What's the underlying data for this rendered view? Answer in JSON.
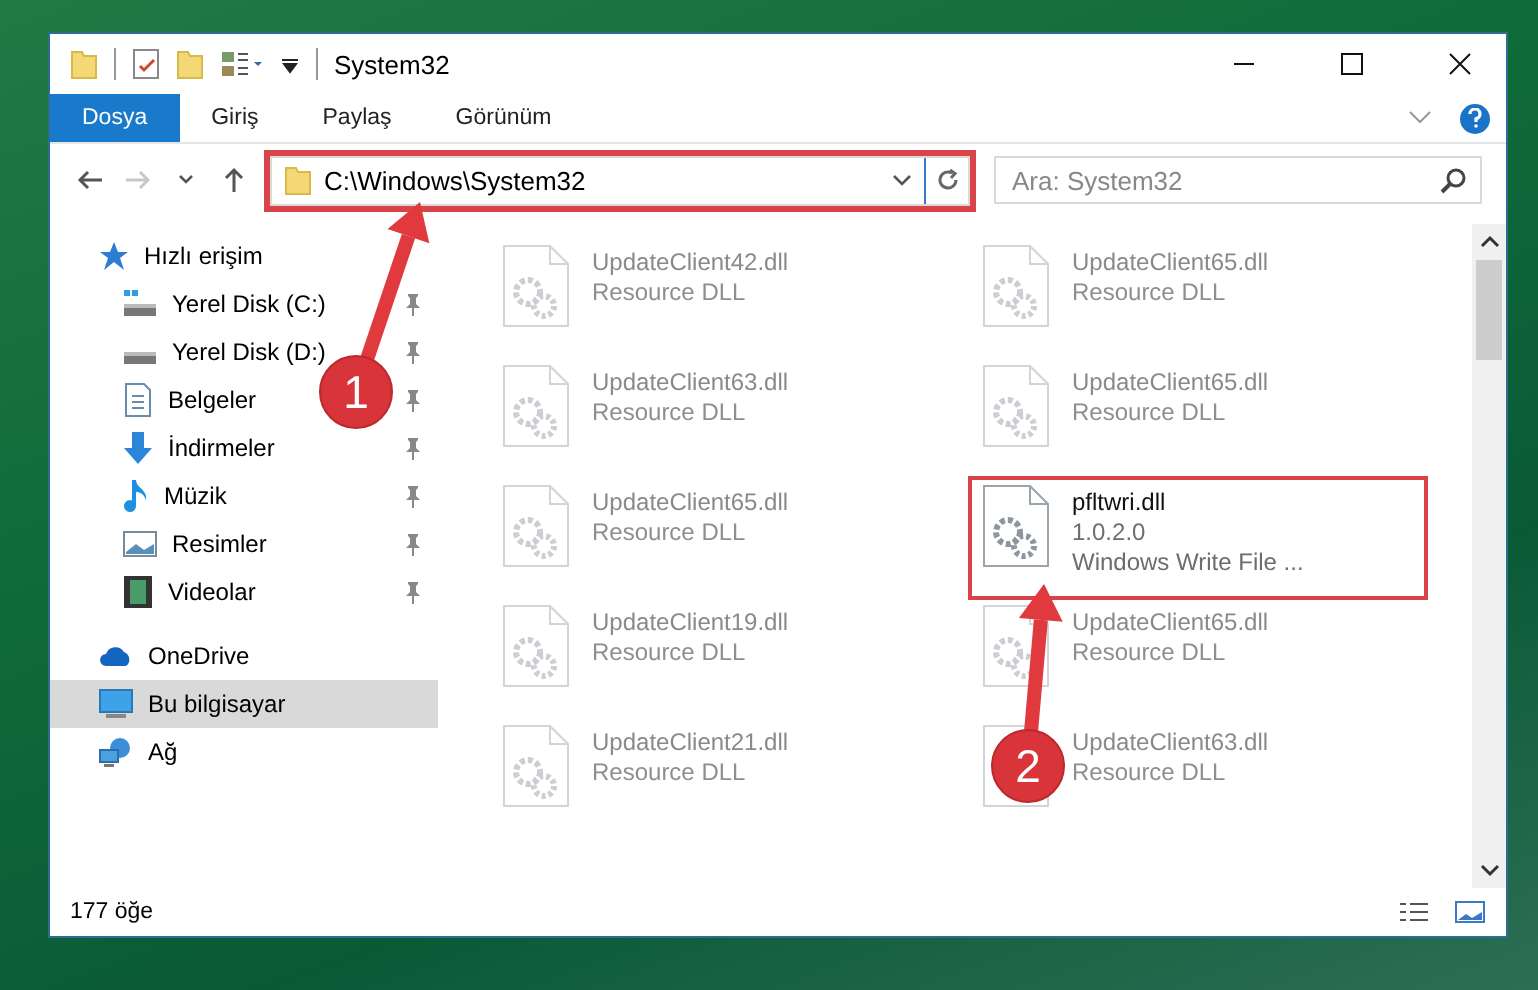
{
  "window": {
    "title": "System32"
  },
  "ribbon": {
    "tabs": [
      {
        "label": "Dosya",
        "selected": true
      },
      {
        "label": "Giriş",
        "selected": false
      },
      {
        "label": "Paylaş",
        "selected": false
      },
      {
        "label": "Görünüm",
        "selected": false
      }
    ]
  },
  "navigation": {
    "forward_disabled": true,
    "address": {
      "value": "C:\\Windows\\System32",
      "highlighted": true
    },
    "search": {
      "placeholder": "Ara: System32"
    }
  },
  "sidebar": {
    "items": [
      {
        "label": "Hızlı erişim",
        "kind": "star",
        "selected": false,
        "children": [
          {
            "label": "Yerel Disk (C:)",
            "kind": "system-drive",
            "pinned": true,
            "selected": false
          },
          {
            "label": "Yerel Disk (D:)",
            "kind": "drive",
            "pinned": true,
            "selected": false
          },
          {
            "label": "Belgeler",
            "kind": "documents",
            "pinned": true,
            "selected": false
          },
          {
            "label": "İndirmeler",
            "kind": "downloads",
            "pinned": true,
            "selected": false
          },
          {
            "label": "Müzik",
            "kind": "music",
            "pinned": true,
            "selected": false
          },
          {
            "label": "Resimler",
            "kind": "pictures",
            "pinned": true,
            "selected": false
          },
          {
            "label": "Videolar",
            "kind": "videos",
            "pinned": true,
            "selected": false
          }
        ]
      },
      {
        "label": "OneDrive",
        "kind": "cloud",
        "selected": false
      },
      {
        "label": "Bu bilgisayar",
        "kind": "computer",
        "selected": true
      },
      {
        "label": "Ağ",
        "kind": "network",
        "selected": false
      }
    ]
  },
  "files": [
    {
      "name": "UpdateClient42.dll",
      "lines": [
        "Resource DLL"
      ],
      "highlighted": false
    },
    {
      "name": "UpdateClient65.dll",
      "lines": [
        "Resource DLL"
      ],
      "highlighted": false
    },
    {
      "name": "UpdateClient63.dll",
      "lines": [
        "Resource DLL"
      ],
      "highlighted": false
    },
    {
      "name": "UpdateClient65.dll",
      "lines": [
        "Resource DLL"
      ],
      "highlighted": false
    },
    {
      "name": "UpdateClient65.dll",
      "lines": [
        "Resource DLL"
      ],
      "highlighted": false
    },
    {
      "name": "pfltwri.dll",
      "lines": [
        "1.0.2.0",
        "Windows Write File ..."
      ],
      "highlighted": true
    },
    {
      "name": "UpdateClient19.dll",
      "lines": [
        "Resource DLL"
      ],
      "highlighted": false
    },
    {
      "name": "UpdateClient65.dll",
      "lines": [
        "Resource DLL"
      ],
      "highlighted": false
    },
    {
      "name": "UpdateClient21.dll",
      "lines": [
        "Resource DLL"
      ],
      "highlighted": false
    },
    {
      "name": "UpdateClient63.dll",
      "lines": [
        "Resource DLL"
      ],
      "highlighted": false
    }
  ],
  "status_bar": {
    "count": "177 öğe"
  },
  "annotations": [
    {
      "label": "1"
    },
    {
      "label": "2"
    }
  ]
}
